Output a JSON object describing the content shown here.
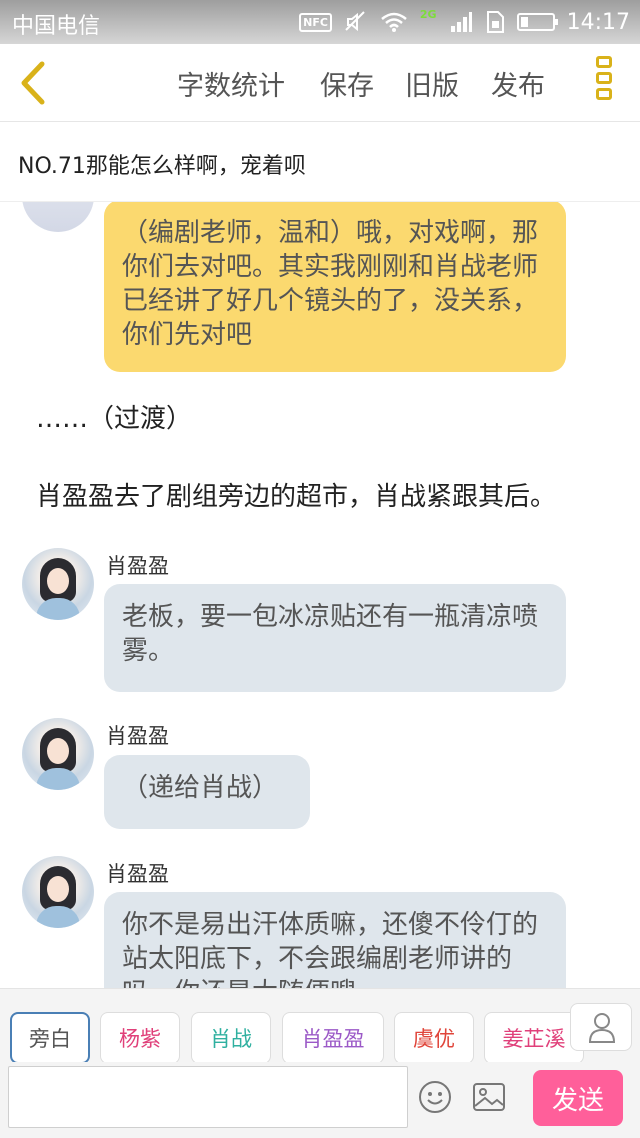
{
  "status_bar": {
    "carrier": "中国电信",
    "nfc": "NFC",
    "network": "2G",
    "battery_level": 0.25,
    "time": "14:17"
  },
  "toolbar": {
    "actions": [
      "字数统计",
      "保存",
      "旧版",
      "发布"
    ],
    "accent_color": "#d9b21a"
  },
  "chapter": {
    "title": "NO.71那能怎么样啊，宠着呗"
  },
  "messages": [
    {
      "type": "bubble",
      "style": "yellow",
      "text": "（编剧老师，温和）哦，对戏啊，那你们去对吧。其实我刚刚和肖战老师已经讲了好几个镜头的了，没关系，你们先对吧"
    },
    {
      "type": "narration",
      "text": "……（过渡）"
    },
    {
      "type": "narration",
      "text": "肖盈盈去了剧组旁边的超市，肖战紧跟其后。"
    },
    {
      "type": "bubble",
      "style": "blue",
      "speaker": "肖盈盈",
      "text": "老板，要一包冰凉贴还有一瓶清凉喷雾。"
    },
    {
      "type": "bubble",
      "style": "blue",
      "speaker": "肖盈盈",
      "text": "（递给肖战）"
    },
    {
      "type": "bubble",
      "style": "blue",
      "speaker": "肖盈盈",
      "text": "你不是易出汗体质嘛，还傻不伶仃的站太阳底下，不会跟编剧老师讲的吗，你还是太随便嗖"
    }
  ],
  "roles": [
    {
      "label": "旁白",
      "color": "#555555"
    },
    {
      "label": "杨紫",
      "color": "#e0407a"
    },
    {
      "label": "肖战",
      "color": "#2fb0a0"
    },
    {
      "label": "肖盈盈",
      "color": "#9b59c7"
    },
    {
      "label": "虞优",
      "color": "#e0453a"
    },
    {
      "label": "姜芷溪",
      "color": "#e0407a"
    }
  ],
  "composer": {
    "placeholder": "",
    "send_label": "发送",
    "send_color": "#ff5f9a"
  }
}
